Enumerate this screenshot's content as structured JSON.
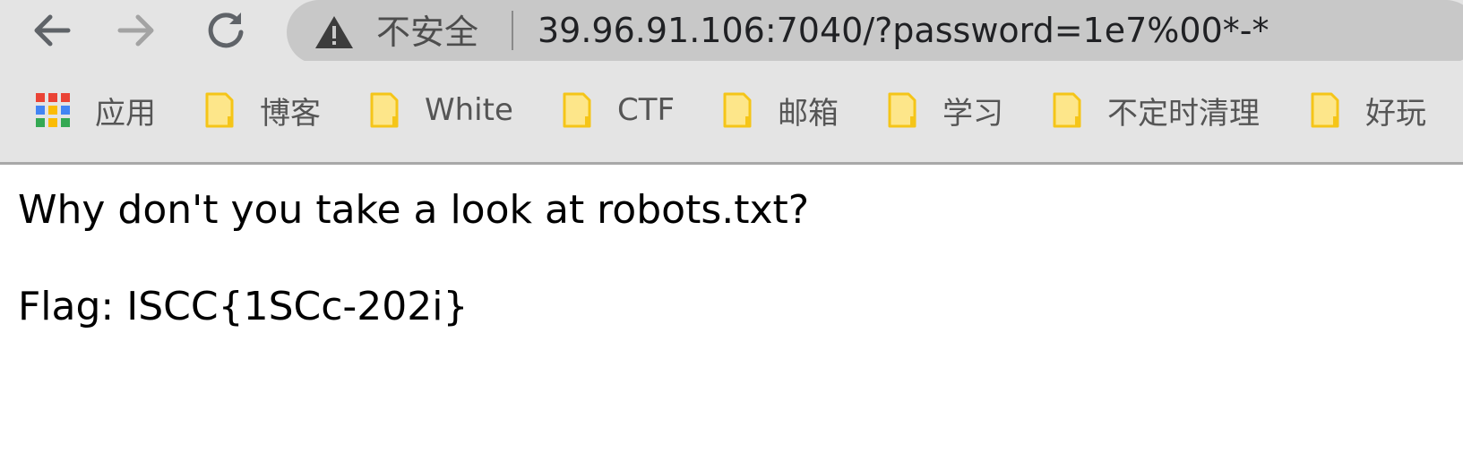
{
  "toolbar": {
    "back_icon": "arrow-left-icon",
    "forward_icon": "arrow-right-icon",
    "reload_icon": "reload-icon",
    "omnibox": {
      "security_icon": "warning-triangle-icon",
      "security_text": "不安全",
      "url": "39.96.91.106:7040/?password=1e7%00*-*"
    }
  },
  "bookmarks": {
    "apps": {
      "label": "应用",
      "icon": "apps-grid-icon"
    },
    "items": [
      {
        "label": "博客",
        "icon": "folder-icon"
      },
      {
        "label": "White",
        "icon": "folder-icon"
      },
      {
        "label": "CTF",
        "icon": "folder-icon"
      },
      {
        "label": "邮箱",
        "icon": "folder-icon"
      },
      {
        "label": "学习",
        "icon": "folder-icon"
      },
      {
        "label": "不定时清理",
        "icon": "folder-icon"
      },
      {
        "label": "好玩",
        "icon": "folder-icon"
      }
    ]
  },
  "page": {
    "line1": "Why don't you take a look at robots.txt?",
    "line2": "Flag: ISCC{1SCc-202i}"
  },
  "colors": {
    "toolbar_bg": "#e4e4e4",
    "omnibox_bg": "#c8c8c8",
    "folder_fill": "#fde68a",
    "folder_stroke": "#f5c518",
    "apps_red": "#ea4335",
    "apps_blue": "#4285f4",
    "apps_yellow": "#fbbc05",
    "apps_green": "#34a853"
  }
}
